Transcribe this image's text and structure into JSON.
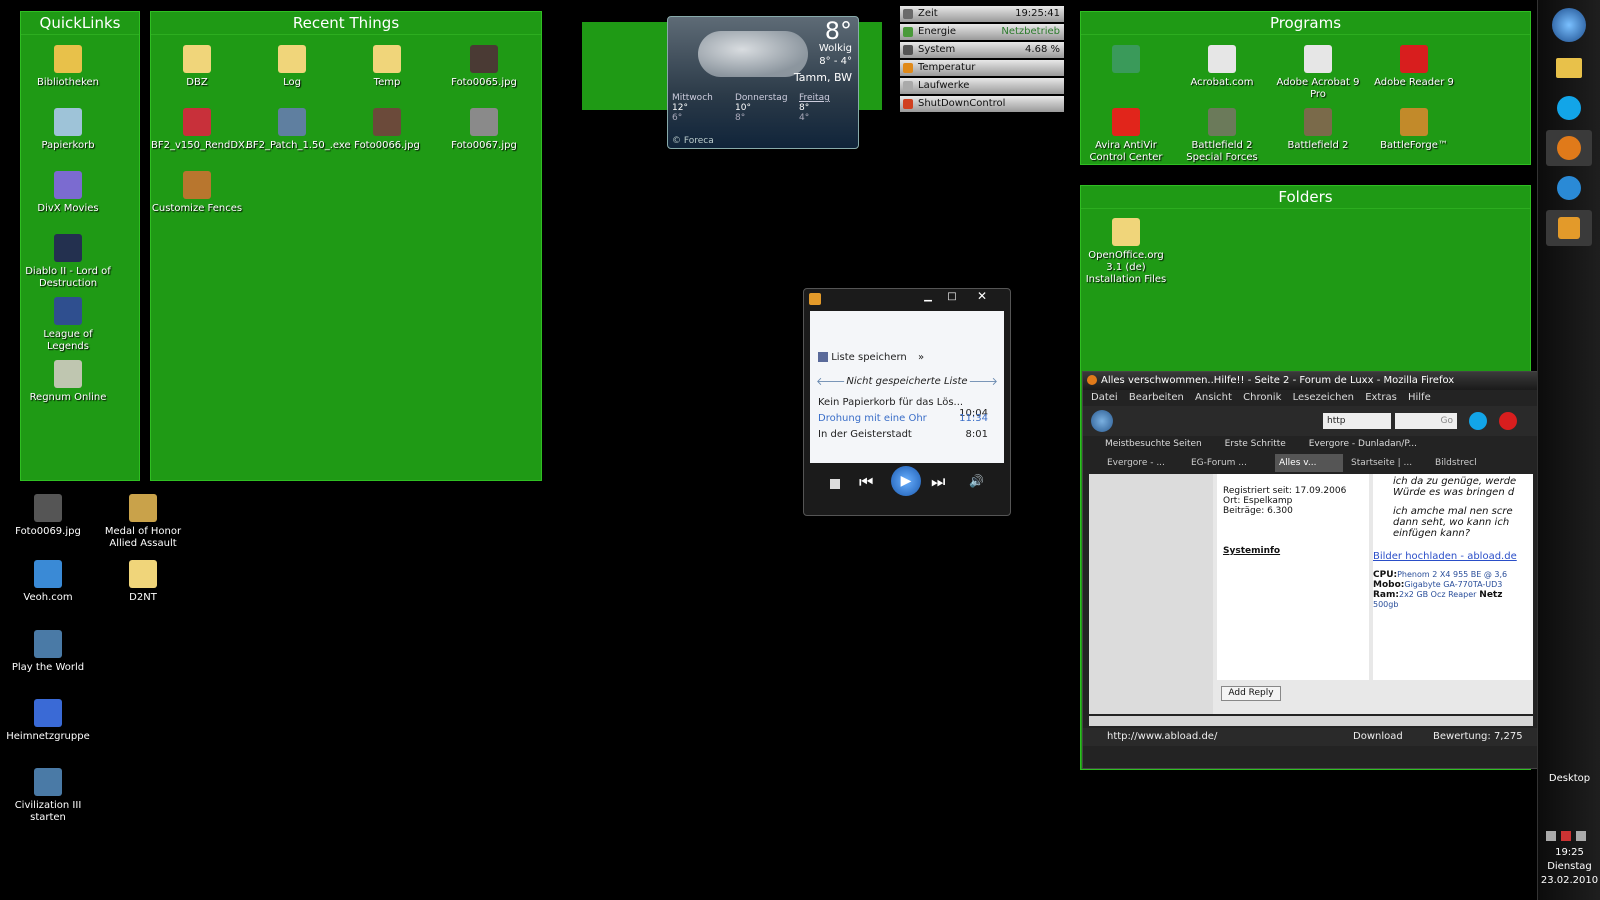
{
  "fences": {
    "quicklinks": {
      "title": "QuickLinks",
      "items": [
        {
          "label": "Bibliotheken",
          "icon": "libraries-icon",
          "color": "#e8c14a"
        },
        {
          "label": "Papierkorb",
          "icon": "recycle-bin-icon",
          "color": "#9ec3d8"
        },
        {
          "label": "DivX Movies",
          "icon": "divx-movies-icon",
          "color": "#7b6bd0"
        },
        {
          "label": "Diablo II - Lord of Destruction",
          "icon": "diablo-icon",
          "color": "#23304f"
        },
        {
          "label": "League of Legends",
          "icon": "league-of-legends-icon",
          "color": "#2f4f8f"
        },
        {
          "label": "Regnum Online",
          "icon": "regnum-online-icon",
          "color": "#bfc6b0"
        }
      ]
    },
    "recent": {
      "title": "Recent Things",
      "items": [
        {
          "label": "DBZ",
          "icon": "folder-icon",
          "color": "#f0d57a"
        },
        {
          "label": "Log",
          "icon": "folder-icon",
          "color": "#f0d57a"
        },
        {
          "label": "Temp",
          "icon": "folder-icon",
          "color": "#f0d57a"
        },
        {
          "label": "Foto0065.jpg",
          "icon": "photo-icon",
          "color": "#4a3a34"
        },
        {
          "label": "BF2_v150_RendDX...",
          "icon": "flag-file-icon",
          "color": "#c8303a"
        },
        {
          "label": "BF2_Patch_1.50_.exe",
          "icon": "patch-exe-icon",
          "color": "#5f7fa0"
        },
        {
          "label": "Foto0066.jpg",
          "icon": "photo-icon",
          "color": "#6b4a3a"
        },
        {
          "label": "Foto0067.jpg",
          "icon": "photo-icon",
          "color": "#8a8a8a"
        },
        {
          "label": "Customize Fences",
          "icon": "fences-icon",
          "color": "#b8762e"
        }
      ]
    },
    "programs": {
      "title": "Programs",
      "items": [
        {
          "label": "",
          "icon": "shortcut-icon",
          "color": "#3a9a5a"
        },
        {
          "label": "Acrobat.com",
          "icon": "acrobat-com-icon",
          "color": "#e6e6e6"
        },
        {
          "label": "Adobe Acrobat 9 Pro",
          "icon": "acrobat-pro-icon",
          "color": "#e6e6e6"
        },
        {
          "label": "Adobe Reader 9",
          "icon": "adobe-reader-icon",
          "color": "#d81e1e"
        },
        {
          "label": "Avira AntiVir Control Center",
          "icon": "avira-icon",
          "color": "#e1251b"
        },
        {
          "label": "Battlefield 2 Special Forces",
          "icon": "battlefield-sf-icon",
          "color": "#6b7a5a"
        },
        {
          "label": "Battlefield 2",
          "icon": "battlefield-icon",
          "color": "#7a6a4a"
        },
        {
          "label": "BattleForge™",
          "icon": "battleforge-icon",
          "color": "#c28a2a"
        }
      ]
    },
    "folders": {
      "title": "Folders",
      "items": [
        {
          "label": "OpenOffice.org 3.1 (de) Installation Files",
          "icon": "folder-icon",
          "color": "#f0d57a"
        }
      ]
    }
  },
  "desktop_icons": [
    {
      "label": "Foto0069.jpg",
      "icon": "photo-icon",
      "color": "#555"
    },
    {
      "label": "Medal of Honor Allied Assault",
      "icon": "medal-of-honor-icon",
      "color": "#c9a24a"
    },
    {
      "label": "Veoh.com",
      "icon": "veoh-icon",
      "color": "#3a8ad6"
    },
    {
      "label": "D2NT",
      "icon": "folder-icon",
      "color": "#f0d57a"
    },
    {
      "label": "Play the World",
      "icon": "civilization-icon",
      "color": "#4a7aa6"
    },
    {
      "label": "Heimnetzgruppe",
      "icon": "homegroup-icon",
      "color": "#3a6ad6"
    },
    {
      "label": "Civilization III starten",
      "icon": "civilization-icon",
      "color": "#4a7aa6"
    }
  ],
  "weather": {
    "temp": "8°",
    "condition": "Wolkig",
    "range": "8° - 4°",
    "location": "Tamm, BW",
    "days": [
      {
        "name": "Mittwoch",
        "hi": "12°",
        "lo": "6°"
      },
      {
        "name": "Donnerstag",
        "hi": "10°",
        "lo": "8°"
      },
      {
        "name": "Freitag",
        "hi": "8°",
        "lo": "4°"
      }
    ],
    "credit": "© Foreca"
  },
  "sysmon": [
    {
      "label": "Zeit",
      "value": "19:25:41",
      "color": "#6a6a6a",
      "icon": "clock-icon"
    },
    {
      "label": "Energie",
      "value": "Netzbetrieb",
      "color": "#4a9a3a",
      "icon": "power-icon"
    },
    {
      "label": "System",
      "value": "4.68 %",
      "color": "#555",
      "icon": "cpu-icon"
    },
    {
      "label": "Temperatur",
      "value": "",
      "color": "#e08a1a",
      "icon": "temperature-icon"
    },
    {
      "label": "Laufwerke",
      "value": "",
      "color": "#aaa",
      "icon": "drives-icon"
    },
    {
      "label": "ShutDownControl",
      "value": "",
      "color": "#d04020",
      "icon": "shutdown-icon"
    }
  ],
  "wmp": {
    "save_label": "Liste speichern",
    "more": "»",
    "playlist_title": "Nicht gespeicherte Liste",
    "tracks": [
      {
        "title": "Kein Papierkorb für das Lös...",
        "time": "10:04"
      },
      {
        "title": "Drohung mit eine Ohr",
        "time": "11:34"
      },
      {
        "title": "In der Geisterstadt",
        "time": "8:01"
      }
    ]
  },
  "firefox": {
    "title": "Alles verschwommen..Hilfe!! - Seite 2 - Forum de Luxx - Mozilla Firefox",
    "menu": [
      "Datei",
      "Bearbeiten",
      "Ansicht",
      "Chronik",
      "Lesezeichen",
      "Extras",
      "Hilfe"
    ],
    "url_fragment": "http",
    "search_placeholder": "Go",
    "bookmarks": [
      "Meistbesuchte Seiten",
      "Erste Schritte",
      "Evergore - Dunladan/P..."
    ],
    "tabs": [
      "Evergore - ...",
      "EG-Forum ...",
      "Alles v...",
      "Startseite | ...",
      "Bildstrecl"
    ],
    "profile": {
      "registered": "Registriert seit: 17.09.2006",
      "location": "Ort: Espelkamp",
      "posts": "Beiträge: 6.300",
      "sysinfo": "Systeminfo"
    },
    "post": {
      "line1": "ich da zu genüge, werde",
      "line2": "Würde es was bringen d",
      "line3": "ich amche mal nen scre",
      "line4": "dann seht, wo kann ich",
      "line5": "einfügen kann?"
    },
    "link": "Bilder hochladen - abload.de",
    "specs": [
      {
        "k": "CPU:",
        "v": "Phenom 2 X4 955 BE @ 3,6"
      },
      {
        "k": "Mobo:",
        "v": "Gigabyte GA-770TA-UD3"
      },
      {
        "k": "Ram:",
        "v": "2x2 GB Ocz Reaper"
      },
      {
        "k": "",
        "v": "500gb"
      }
    ],
    "netz": "Netz",
    "add_reply": "Add Reply",
    "status_url": "http://www.abload.de/",
    "download": "Download",
    "rating": "Bewertung: 7,275"
  },
  "taskbar": {
    "desktop_label": "Desktop",
    "time": "19:25",
    "day": "Dienstag",
    "date": "23.02.2010"
  }
}
